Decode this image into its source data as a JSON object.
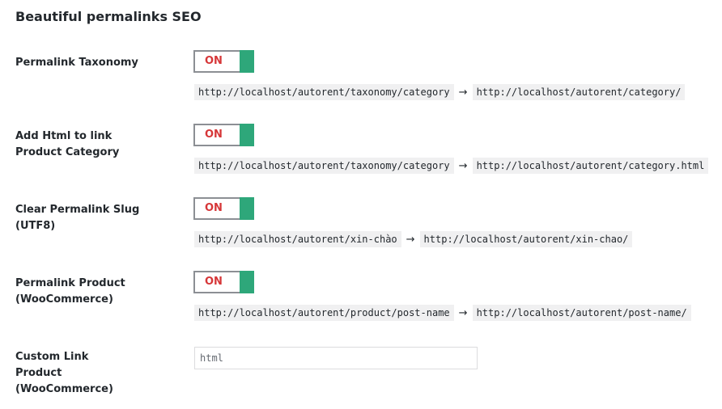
{
  "section": {
    "title": "Beautiful permalinks SEO"
  },
  "rows": [
    {
      "label": "Permalink Taxonomy",
      "toggle": "ON",
      "from": "http://localhost/autorent/taxonomy/category",
      "arrow": "→",
      "to": "http://localhost/autorent/category/"
    },
    {
      "label": "Add Html to link Product Category",
      "toggle": "ON",
      "from": "http://localhost/autorent/taxonomy/category",
      "arrow": "→",
      "to": "http://localhost/autorent/category.html"
    },
    {
      "label": "Clear Permalink Slug (UTF8)",
      "toggle": "ON",
      "from": "http://localhost/autorent/xin-chào",
      "arrow": "→",
      "to": "http://localhost/autorent/xin-chao/"
    },
    {
      "label": "Permalink Product (WooCommerce)",
      "toggle": "ON",
      "from": "http://localhost/autorent/product/post-name",
      "arrow": "→",
      "to": "http://localhost/autorent/post-name/"
    }
  ],
  "custom_link": {
    "label": "Custom Link Product (WooCommerce)",
    "value": "html"
  },
  "colors": {
    "toggle_on_text": "#d63638",
    "toggle_knob": "#2ea77a",
    "code_background": "#f0f0f1"
  }
}
